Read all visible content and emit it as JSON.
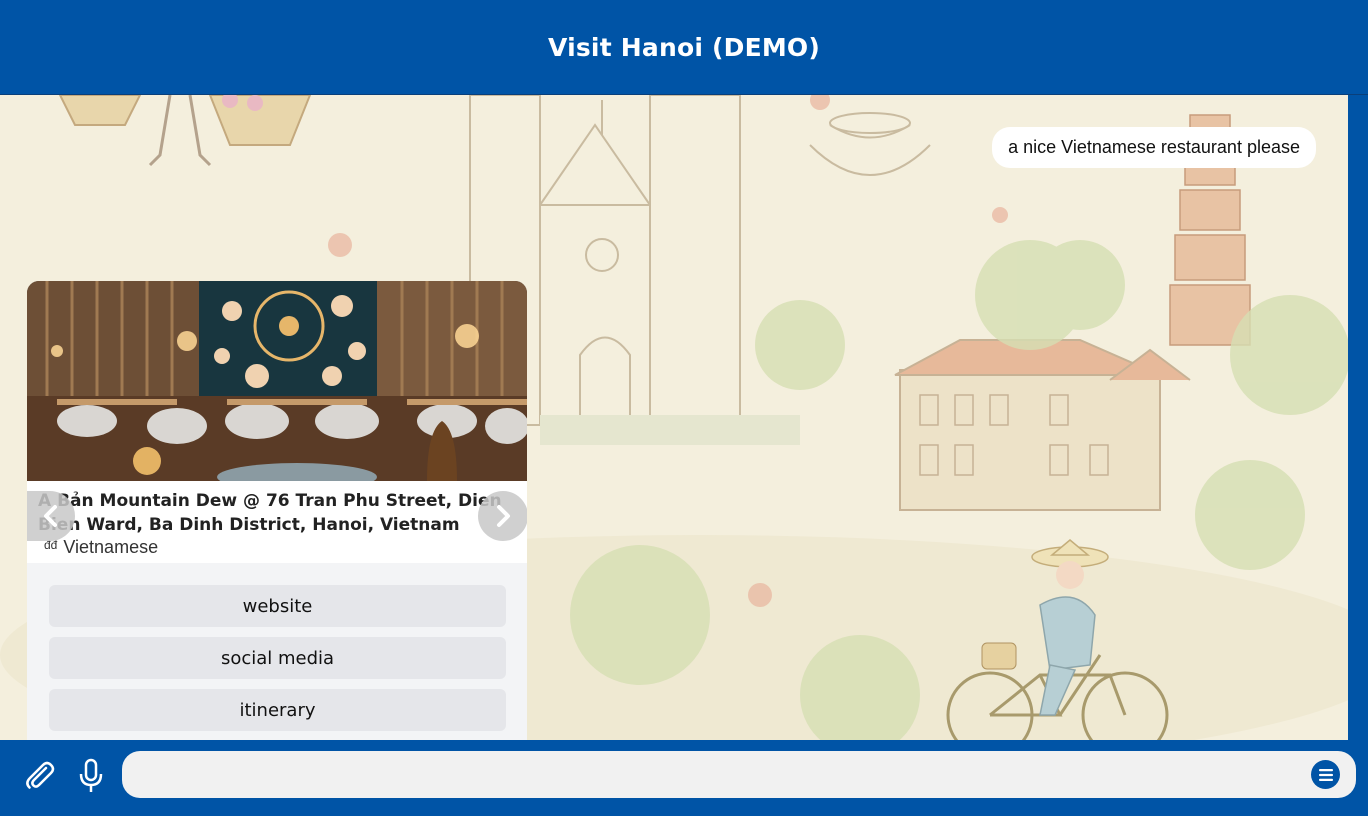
{
  "header": {
    "title": "Visit Hanoi (DEMO)"
  },
  "chat": {
    "user_message": "a nice Vietnamese restaurant please",
    "card": {
      "title": "A Bản Mountain Dew @ 76 Tran Phu Street, Dien Bien Ward, Ba Dinh District, Hanoi, Vietnam",
      "price": "đđ",
      "cuisine": "Vietnamese",
      "buttons": [
        "website",
        "social media",
        "itinerary"
      ]
    }
  },
  "footer": {
    "input_value": "",
    "attach_icon": "paperclip-icon",
    "mic_icon": "microphone-icon",
    "menu_icon": "menu-icon"
  },
  "colors": {
    "brand": "#0054a6",
    "background": "#f4efdd"
  }
}
